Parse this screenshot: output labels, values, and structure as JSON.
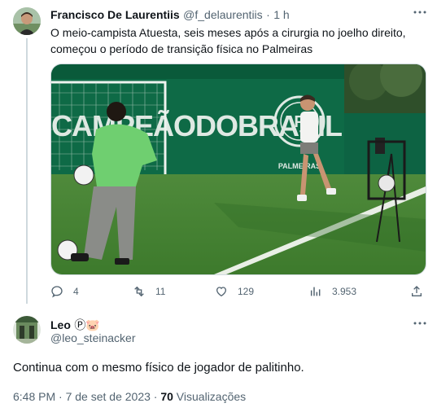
{
  "tweet": {
    "author_name": "Francisco De Laurentiis",
    "author_handle": "@f_delaurentiis",
    "time": "1 h",
    "dot": "·",
    "text_line1": "O meio-campista Atuesta, seis meses após a cirurgia no joelho direito,",
    "text_line2": "começou o período de transição física no Palmeiras",
    "media_banner_text": "CAMPEÃODOBRASIL",
    "media_wall_text": "PALMEIRAS",
    "actions": {
      "replies": "4",
      "retweets": "11",
      "likes": "129",
      "views": "3.953"
    }
  },
  "reply": {
    "author_name": "Leo",
    "author_badges": "Ⓟ🐷",
    "author_handle": "@leo_steinacker",
    "text": "Continua com o mesmo físico de jogador de palitinho.",
    "timestamp": "6:48 PM · 7 de set de 2023 · ",
    "views_count": "70",
    "views_label": " Visualizações"
  },
  "colors": {
    "accent": "#1d9bf0",
    "muted": "#536471",
    "text": "#0f1419",
    "palmeiras_green": "#0b5b3e"
  }
}
